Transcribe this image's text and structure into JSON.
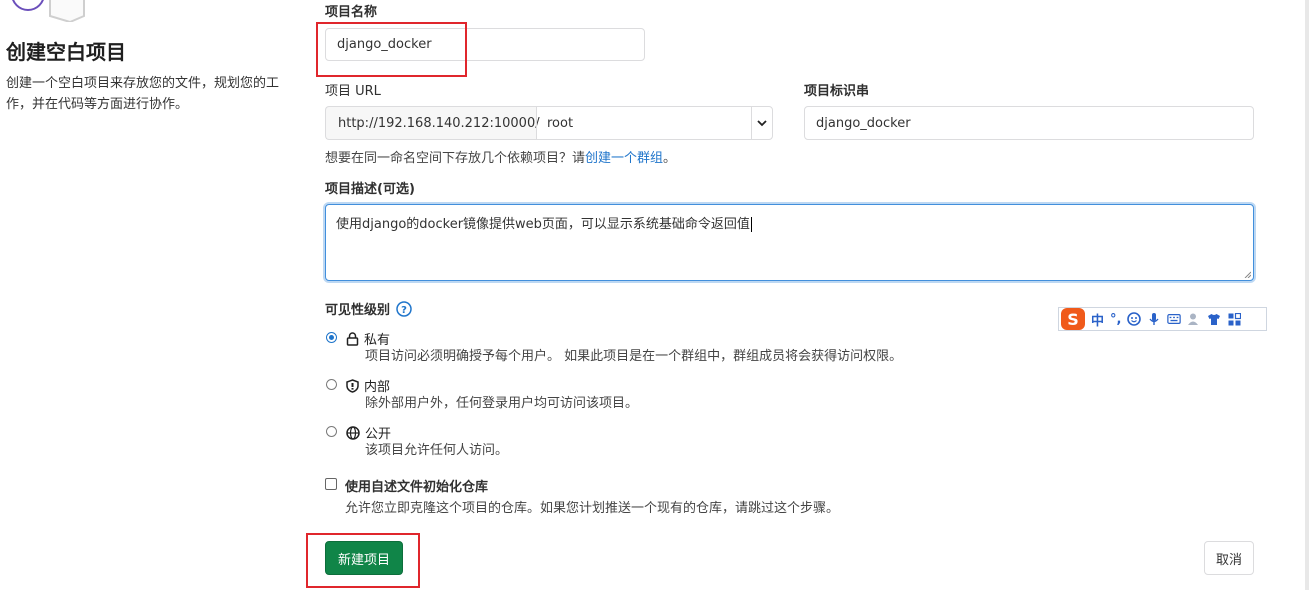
{
  "left": {
    "title": "创建空白项目",
    "description": "创建一个空白项目来存放您的文件，规划您的工作，并在代码等方面进行协作。"
  },
  "form": {
    "project_name_label": "项目名称",
    "project_name_value": "django_docker",
    "project_url_label": "项目 URL",
    "url_prefix": "http://192.168.140.212:10000/",
    "namespace": "root",
    "slug_label": "项目标识串",
    "slug_value": "django_docker",
    "group_hint_prefix": "想要在同一命名空间下存放几个依赖项目？请",
    "group_hint_link": "创建一个群组",
    "group_hint_suffix": "。",
    "description_label": "项目描述(可选)",
    "description_value": "使用django的docker镜像提供web页面，可以显示系统基础命令返回值",
    "visibility_label": "可见性级别",
    "visibility": [
      {
        "title": "私有",
        "icon": "lock-icon",
        "desc": "项目访问必须明确授予每个用户。 如果此项目是在一个群组中，群组成员将会获得访问权限。",
        "checked": true
      },
      {
        "title": "内部",
        "icon": "shield-icon",
        "desc": "除外部用户外，任何登录用户均可访问该项目。",
        "checked": false
      },
      {
        "title": "公开",
        "icon": "globe-icon",
        "desc": "该项目允许任何人访问。",
        "checked": false
      }
    ],
    "readme_label": "使用自述文件初始化仓库",
    "readme_desc": "允许您立即克隆这个项目的仓库。如果您计划推送一个现有的仓库，请跳过这个步骤。",
    "create_button": "新建项目",
    "cancel_button": "取消"
  },
  "ime": {
    "mode": "中",
    "punct": "°,"
  },
  "colors": {
    "primary": "#108548",
    "link": "#1f75cb",
    "highlight": "#e0262c",
    "focus": "#428fdc"
  }
}
